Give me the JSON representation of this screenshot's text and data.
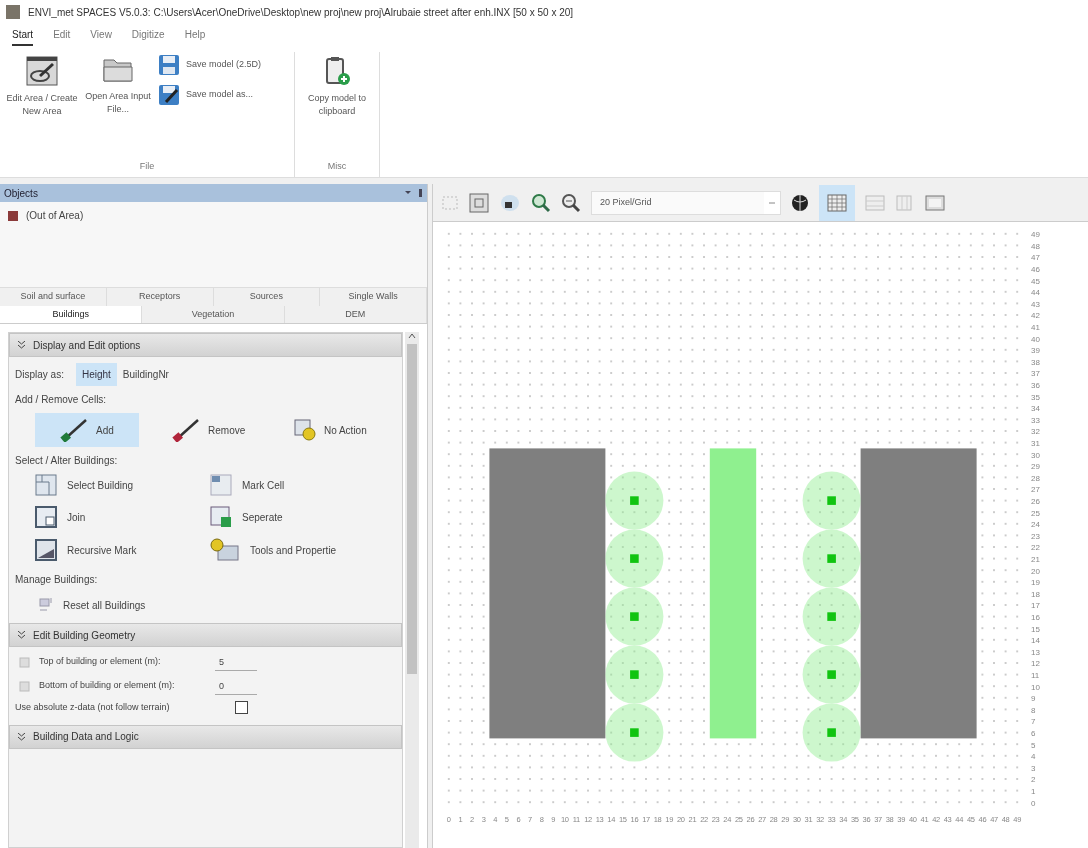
{
  "window": {
    "title": "ENVI_met SPACES V5.0.3:  C:\\Users\\Acer\\OneDrive\\Desktop\\new proj\\new proj\\Alrubaie street after enh.INX [50 x 50 x 20]"
  },
  "menu": [
    {
      "label": "Start",
      "selected": true
    },
    {
      "label": "Edit",
      "selected": false
    },
    {
      "label": "View",
      "selected": false
    },
    {
      "label": "Digitize",
      "selected": false
    },
    {
      "label": "Help",
      "selected": false
    }
  ],
  "ribbon": {
    "groups": [
      {
        "label": "File",
        "buttons": [
          {
            "kind": "large",
            "label": "Edit Area / Create New Area"
          },
          {
            "kind": "large",
            "label": "Open Area Input File..."
          },
          {
            "kind": "small",
            "label": "Save model (2.5D)"
          },
          {
            "kind": "small",
            "label": "Save model as..."
          }
        ]
      },
      {
        "label": "Misc",
        "buttons": [
          {
            "kind": "large",
            "label": "Copy model to clipboard"
          }
        ]
      }
    ]
  },
  "objects_panel": {
    "title": "Objects",
    "items": [
      {
        "label": "(Out of Area)",
        "color": "#8b3a3a"
      }
    ],
    "tabs_row_1": [
      {
        "label": "Soil and surface",
        "selected": false
      },
      {
        "label": "Receptors",
        "selected": false
      },
      {
        "label": "Sources",
        "selected": false
      },
      {
        "label": "Single Walls",
        "selected": false
      }
    ],
    "tabs_row_2": [
      {
        "label": "Buildings",
        "selected": true
      },
      {
        "label": "Vegetation",
        "selected": false
      },
      {
        "label": "DEM",
        "selected": false
      }
    ]
  },
  "display_section": {
    "title": "Display and Edit options",
    "display_as_label": "Display as:",
    "display_options": [
      {
        "label": "Height",
        "selected": true
      },
      {
        "label": "BuildingNr",
        "selected": false
      }
    ],
    "add_remove_label": "Add / Remove Cells:",
    "add_remove": [
      {
        "label": "Add",
        "selected": true
      },
      {
        "label": "Remove",
        "selected": false
      },
      {
        "label": "No Action",
        "selected": false
      }
    ],
    "select_label": "Select / Alter Buildings:",
    "select_tools": [
      {
        "label": "Select Building"
      },
      {
        "label": "Mark Cell"
      },
      {
        "label": "Join"
      },
      {
        "label": "Seperate"
      },
      {
        "label": "Recursive Mark"
      },
      {
        "label": "Tools and Propertie"
      }
    ],
    "manage_label": "Manage Buildings:",
    "manage_tools": [
      {
        "label": "Reset all Buildings"
      }
    ]
  },
  "geometry_section": {
    "title": "Edit Building Geometry",
    "fields": [
      {
        "label": "Top of building or element (m):",
        "value": "5"
      },
      {
        "label": "Bottom of building or element (m):",
        "value": "0"
      }
    ],
    "absolute_z": {
      "label": "Use absolute z-data (not follow terrain)",
      "checked": false
    }
  },
  "logic_section": {
    "title": "Building Data and Logic"
  },
  "toolbar": {
    "zoom_select": {
      "value": "20 Pixel/Grid"
    },
    "grid_toggle": {
      "selected": true
    }
  },
  "grid": {
    "y_labels": [
      "49",
      "48",
      "47",
      "46",
      "45",
      "44",
      "43",
      "42",
      "41",
      "40",
      "39",
      "38",
      "37",
      "36",
      "35",
      "34",
      "33",
      "32",
      "31",
      "30",
      "29",
      "28",
      "27",
      "26",
      "25",
      "24",
      "23",
      "22",
      "21",
      "20",
      "19",
      "18",
      "17",
      "16",
      "15",
      "14",
      "13",
      "12",
      "11",
      "10",
      "9",
      "8",
      "7",
      "6",
      "5",
      "4",
      "3",
      "2",
      "1",
      "0"
    ],
    "x_labels": [
      "0",
      "1",
      "2",
      "3",
      "4",
      "5",
      "6",
      "7",
      "8",
      "9",
      "10",
      "11",
      "12",
      "13",
      "14",
      "15",
      "16",
      "17",
      "18",
      "19",
      "20",
      "21",
      "22",
      "23",
      "24",
      "25",
      "26",
      "27",
      "28",
      "29",
      "30",
      "31",
      "32",
      "33",
      "34",
      "35",
      "36",
      "37",
      "38",
      "39",
      "40",
      "41",
      "42",
      "43",
      "44",
      "45",
      "46",
      "47",
      "48",
      "49"
    ]
  }
}
